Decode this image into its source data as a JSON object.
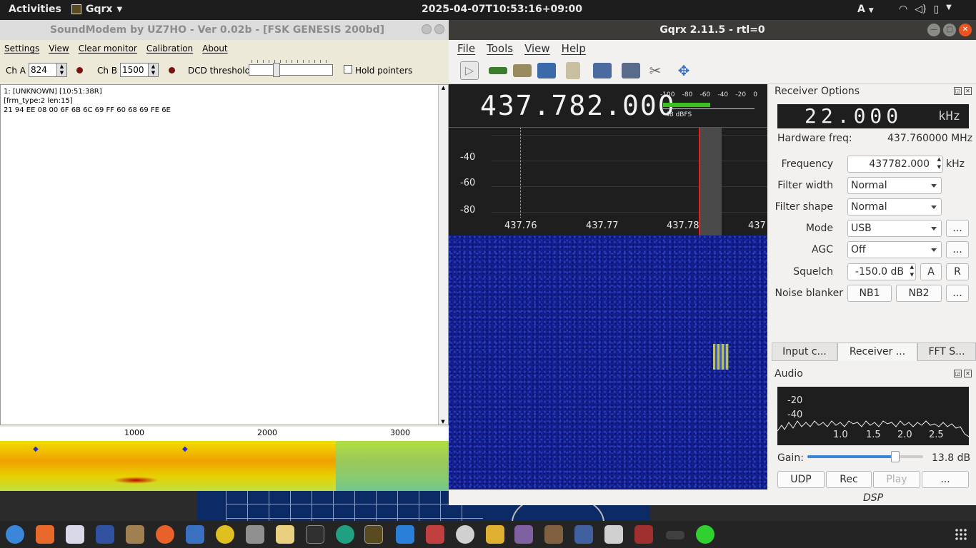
{
  "topbar": {
    "activities": "Activities",
    "app": "Gqrx",
    "clock": "2025-04-07T10:53:16+09:00",
    "keyboard": "A"
  },
  "soundmodem": {
    "title": "SoundModem by UZ7HO - Ver 0.02b - [FSK GENESIS 200bd]",
    "menu": [
      "Settings",
      "View",
      "Clear monitor",
      "Calibration",
      "About"
    ],
    "cha_label": "Ch A",
    "cha_value": "824",
    "chb_label": "Ch B",
    "chb_value": "1500",
    "dcd_label": "DCD threshold",
    "hold_label": "Hold pointers",
    "monitor_lines": [
      "1: [UNKNOWN] [10:51:38R]",
      "[frm_type:2 len:15]",
      "21 94 EE 08 00 6F 6B 6C 69 FF 60 68 69 FE 6E"
    ],
    "ruler_ticks": [
      "1000",
      "2000",
      "3000"
    ]
  },
  "gqrx": {
    "title": "Gqrx 2.11.5 - rtl=0",
    "menu": [
      "File",
      "Tools",
      "View",
      "Help"
    ],
    "frequency_display": "437.782.000",
    "smeter": {
      "scale": [
        "-100",
        "-80",
        "-60",
        "-40",
        "-20",
        "0"
      ],
      "level": "-48 dBFS"
    },
    "plot": {
      "ylabels": [
        "-40",
        "-60",
        "-80"
      ],
      "xlabels": [
        "437.76",
        "437.77",
        "437.78",
        "437"
      ]
    },
    "receiver": {
      "panel_title": "Receiver Options",
      "offset": "22.000",
      "offset_unit": "kHz",
      "hw_label": "Hardware freq:",
      "hw_value": "437.760000 MHz",
      "freq_label": "Frequency",
      "freq_value": "437782.000",
      "freq_unit": "kHz",
      "fw_label": "Filter width",
      "fw_value": "Normal",
      "fs_label": "Filter shape",
      "fs_value": "Normal",
      "mode_label": "Mode",
      "mode_value": "USB",
      "agc_label": "AGC",
      "agc_value": "Off",
      "sq_label": "Squelch",
      "sq_value": "-150.0 dB",
      "sq_a": "A",
      "sq_r": "R",
      "nb_label": "Noise blanker",
      "nb1": "NB1",
      "nb2": "NB2",
      "dots": "..."
    },
    "tabs": [
      "Input c...",
      "Receiver ...",
      "FFT S..."
    ],
    "audio": {
      "panel_title": "Audio",
      "ylabels": [
        "-20",
        "-40"
      ],
      "xlabels": [
        "1.0",
        "1.5",
        "2.0",
        "2.5"
      ],
      "gain_label": "Gain:",
      "gain_value": "13.8 dB",
      "gain_fraction": 0.76,
      "btn_udp": "UDP",
      "btn_rec": "Rec",
      "btn_play": "Play",
      "btn_more": "...",
      "dsp": "DSP"
    }
  },
  "colors": {
    "topbar": "#1d1d1d",
    "gqrx_title": "#3c3b37",
    "waterfall": "#14208e",
    "accent": "#3a86d8"
  }
}
